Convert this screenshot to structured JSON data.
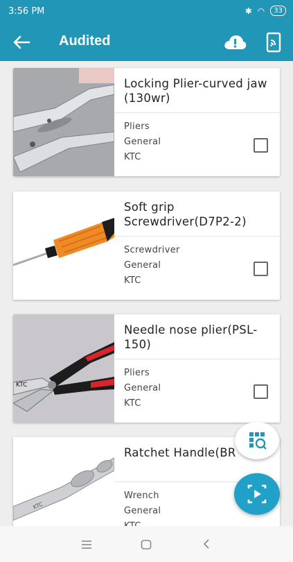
{
  "status_bar": {
    "time": "3:56 PM",
    "battery": "33"
  },
  "app_bar": {
    "title": "Audited"
  },
  "items": [
    {
      "title": "Locking Plier-curved jaw (130wr)",
      "category": "Pliers",
      "type": "General",
      "brand": "KTC",
      "checked": false,
      "icon": "locking-plier"
    },
    {
      "title": "Soft grip Screwdriver(D7P2-2)",
      "category": "Screwdriver",
      "type": "General",
      "brand": "KTC",
      "checked": false,
      "icon": "screwdriver"
    },
    {
      "title": "Needle nose plier(PSL-150)",
      "category": "Pliers",
      "type": "General",
      "brand": "KTC",
      "checked": false,
      "icon": "needle-nose-plier"
    },
    {
      "title": "Ratchet Handle(BR",
      "category": "Wrench",
      "type": "General",
      "brand": "KTC",
      "checked": false,
      "icon": "ratchet-handle"
    }
  ],
  "colors": {
    "primary": "#2196b6",
    "fab": "#21a0c8"
  }
}
